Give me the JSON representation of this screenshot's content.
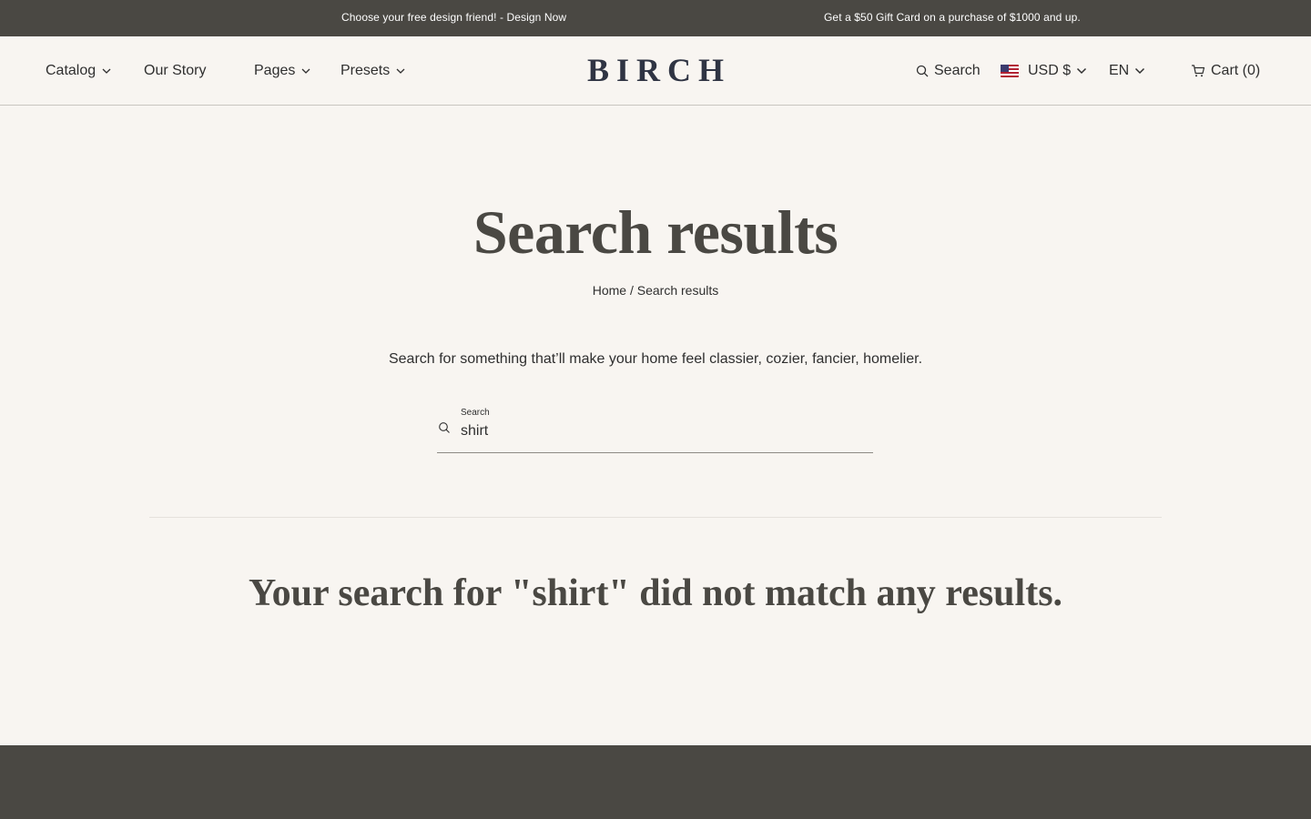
{
  "announcement": {
    "left": "Choose your free design friend! - Design Now",
    "right": "Get a $50 Gift Card on a purchase of $1000 and up."
  },
  "header": {
    "logo": "BIRCH",
    "nav": {
      "catalog": "Catalog",
      "our_story": "Our Story",
      "pages": "Pages",
      "presets": "Presets"
    },
    "search_label": "Search",
    "currency": "USD $",
    "language": "EN",
    "cart_label": "Cart (0)"
  },
  "page": {
    "title": "Search results",
    "breadcrumb": {
      "home": "Home",
      "separator": "/",
      "current": "Search results"
    },
    "intro": "Search for something that’ll make your home feel classier, cozier, fancier, homelier.",
    "search": {
      "label": "Search",
      "value": "shirt"
    },
    "no_results": "Your search for \"shirt\" did not match any results."
  },
  "colors": {
    "background": "#f8f5f1",
    "announcement_bg": "#4a4843",
    "footer_bg": "#4a4843",
    "logo": "#2f3443"
  },
  "icons": {
    "search": "search-icon",
    "cart": "cart-icon",
    "chevron": "chevron-down-icon",
    "flag": "us-flag-icon"
  }
}
